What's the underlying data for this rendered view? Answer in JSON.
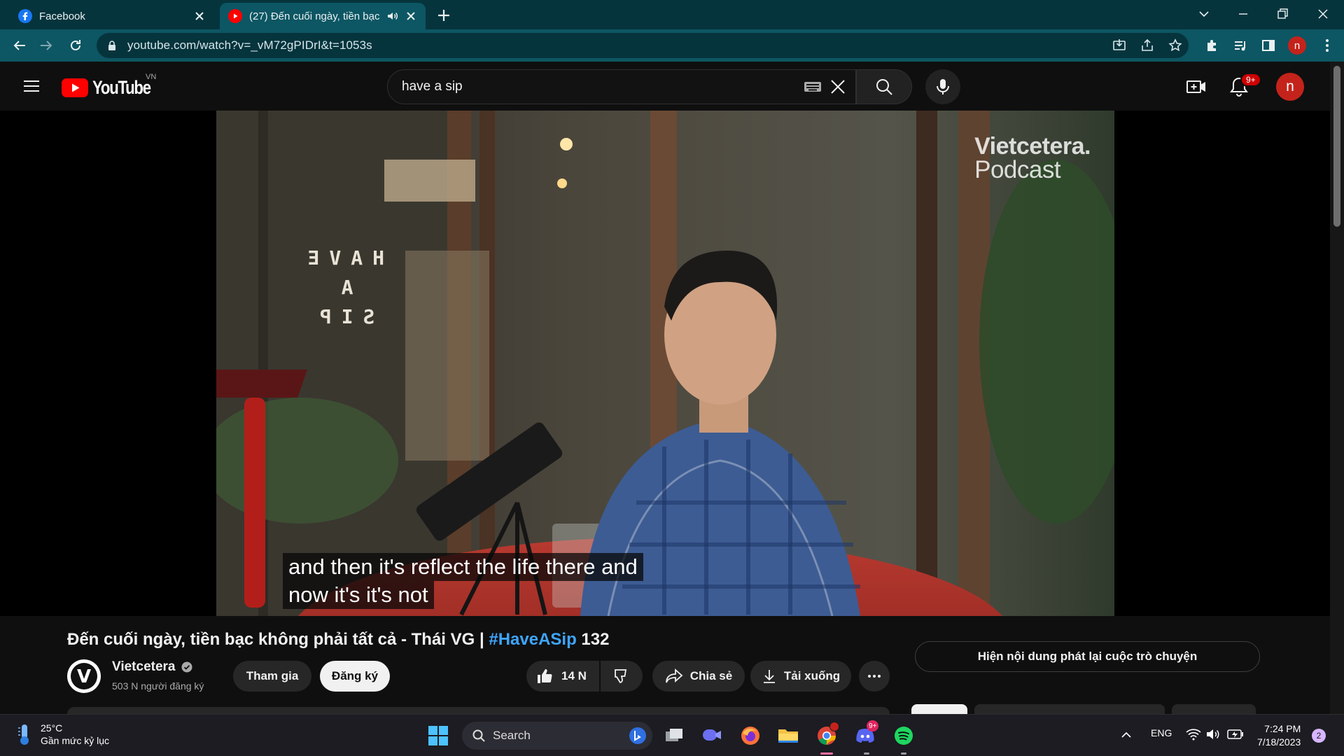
{
  "browser": {
    "tabs": [
      {
        "title": "Facebook",
        "active": false
      },
      {
        "title": "(27) Đến cuối ngày, tiền bạc không phải tất cả - Thái VG | #HaveASip 132",
        "active": true,
        "audio": true
      }
    ],
    "url": "youtube.com/watch?v=_vM72gPIDrI&t=1053s",
    "profile_initial": "n"
  },
  "youtube": {
    "region": "VN",
    "logo_text": "YouTube",
    "search_query": "have a sip",
    "notification_badge": "9+",
    "avatar_initial": "n"
  },
  "video": {
    "watermark_line1": "Vietcetera.",
    "watermark_line2": "Podcast",
    "caption_line1": "and then it's reflect the life there and",
    "caption_line2": "now it's it's not",
    "sign_letters": "HAVE A SIP"
  },
  "info": {
    "title_main": "Đến cuối ngày, tiền bạc không phải tất cả - Thái VG | ",
    "title_tag": "#HaveASip",
    "title_num": " 132",
    "channel_name": "Vietcetera",
    "channel_initial": "V",
    "subscribers": "503 N người đăng ký",
    "join_label": "Tham gia",
    "subscribe_label": "Đăng ký",
    "like_count": "14 N",
    "share_label": "Chia sẻ",
    "download_label": "Tải xuống",
    "chat_replay_label": "Hiện nội dung phát lại cuộc trò chuyện"
  },
  "taskbar": {
    "temperature": "25°C",
    "weather_desc": "Gần mức kỷ lục",
    "search_label": "Search",
    "language": "ENG",
    "time": "7:24 PM",
    "date": "7/18/2023",
    "notification_count": "2",
    "discord_badge": "9+"
  },
  "colors": {
    "chrome_dark": "#06343d",
    "chrome_toolbar": "#0d5663",
    "yt_red": "#ff0000",
    "link_blue": "#3ea6ff"
  }
}
